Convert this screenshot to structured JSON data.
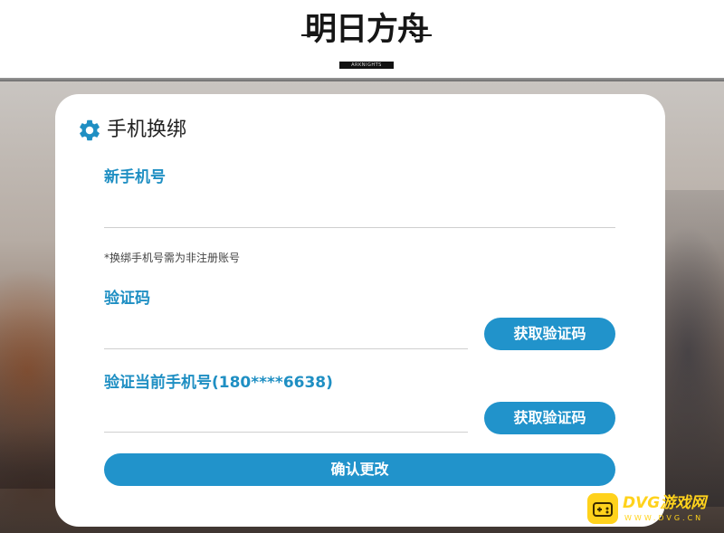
{
  "header": {
    "logo_text": "明日方舟",
    "logo_subtext": "ARKNIGHTS"
  },
  "card": {
    "title": "手机换绑",
    "icon": "gear-icon",
    "new_phone": {
      "label": "新手机号",
      "value": "",
      "placeholder": ""
    },
    "hint": "*换绑手机号需为非注册账号",
    "code": {
      "label": "验证码",
      "value": "",
      "button_label": "获取验证码"
    },
    "verify_current": {
      "label": "验证当前手机号(180****6638)",
      "value": "",
      "button_label": "获取验证码"
    },
    "confirm_label": "确认更改"
  },
  "watermark": {
    "text": "DVG游戏网",
    "subtext": "WWW.DVG.CN"
  },
  "colors": {
    "accent": "#2193cb",
    "label": "#1f8fc3",
    "watermark": "#ffd21c"
  }
}
